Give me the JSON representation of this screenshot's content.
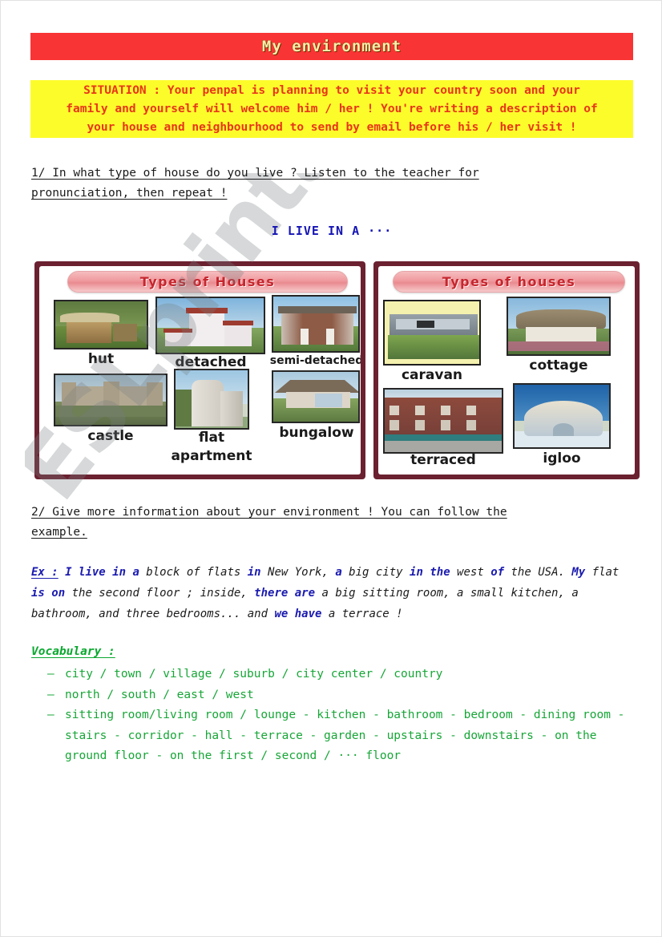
{
  "title_banner": {
    "text": "My environment",
    "bg": "#f93434",
    "fg": "#ffeeaa"
  },
  "situation": {
    "bg": "#fdfc2b",
    "fg": "#e8361a",
    "lines": [
      "SITUATION : Your penpal is planning to visit your country soon and your",
      "family and yourself will welcome him / her ! You're writing a description of",
      "your house and neighbourhood to send by email before his / her visit !"
    ]
  },
  "instruction_1": {
    "lines": [
      "1/ In what type of house do you live ? Listen to the teacher for",
      "pronunciation, then repeat !"
    ]
  },
  "live_in_heading": "I LIVE IN A ···",
  "posters": {
    "left": {
      "title": "Types of Houses",
      "items": [
        {
          "label": "hut"
        },
        {
          "label": "detached"
        },
        {
          "label": "semi-detached"
        },
        {
          "label": "castle"
        },
        {
          "label": "flat"
        },
        {
          "label": "apartment"
        },
        {
          "label": "bungalow"
        }
      ]
    },
    "right": {
      "title": "Types of houses",
      "items": [
        {
          "label": "caravan"
        },
        {
          "label": "cottage"
        },
        {
          "label": "terraced"
        },
        {
          "label": "igloo"
        }
      ]
    }
  },
  "instruction_2": {
    "lines": [
      "2/ Give more information about your environment ! You can follow the",
      "example."
    ]
  },
  "example": {
    "segments": [
      {
        "text": "Ex :",
        "style": "bold-underline-blue"
      },
      {
        "text": " ",
        "style": "plain"
      },
      {
        "text": "I live in a",
        "style": "bold-blue"
      },
      {
        "text": " block of flats ",
        "style": "plain"
      },
      {
        "text": "in",
        "style": "bold-blue"
      },
      {
        "text": " New York, ",
        "style": "plain"
      },
      {
        "text": "a",
        "style": "bold-blue"
      },
      {
        "text": " big city ",
        "style": "plain"
      },
      {
        "text": "in the",
        "style": "bold-blue"
      },
      {
        "text": " west ",
        "style": "plain"
      },
      {
        "text": "of",
        "style": "bold-blue"
      },
      {
        "text": " the USA. ",
        "style": "plain"
      },
      {
        "text": "My",
        "style": "bold-blue"
      },
      {
        "text": " flat ",
        "style": "plain"
      },
      {
        "text": "is on",
        "style": "bold-blue"
      },
      {
        "text": " the second floor ; inside,  ",
        "style": "plain"
      },
      {
        "text": "there are",
        "style": "bold-blue"
      },
      {
        "text": " a big sitting room, a small kitchen, a bathroom, and three bedrooms... and ",
        "style": "plain"
      },
      {
        "text": "we have",
        "style": "bold-blue"
      },
      {
        "text": " a terrace !",
        "style": "plain"
      }
    ]
  },
  "vocabulary": {
    "heading": "Vocabulary :",
    "color": "#17a637",
    "bullet": "–",
    "items": [
      "city / town / village / suburb / city center / country",
      "north / south / east / west",
      "sitting room/living room / lounge -  kitchen - bathroom - bedroom - dining room - stairs - corridor - hall - terrace - garden - upstairs - downstairs - on the ground floor - on the first / second / ··· floor"
    ]
  },
  "watermark": {
    "text": "ESLprintables.com"
  }
}
